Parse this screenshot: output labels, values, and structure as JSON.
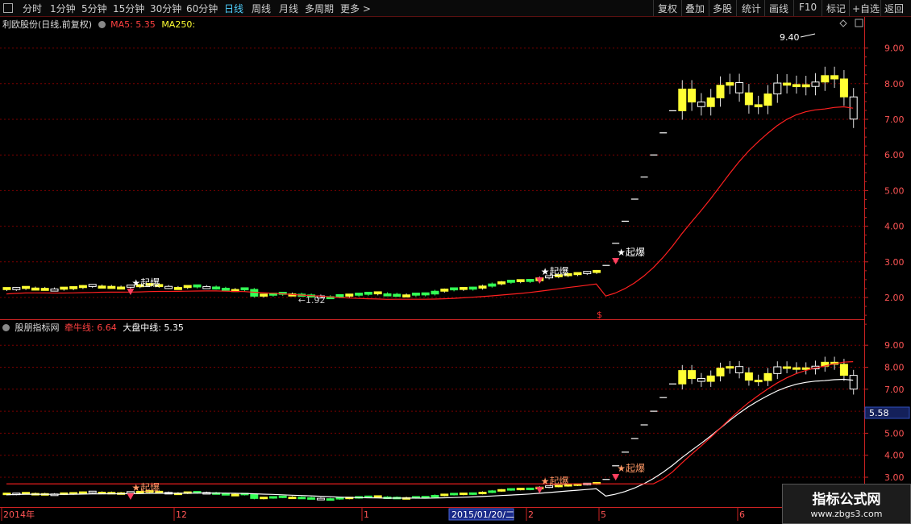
{
  "toolbar": {
    "periods": [
      "分时",
      "1分钟",
      "5分钟",
      "15分钟",
      "30分钟",
      "60分钟",
      "日线",
      "周线",
      "月线",
      "多周期",
      "更多 >"
    ],
    "active_period": "日线",
    "right_buttons": [
      "复权",
      "叠加",
      "多股",
      "统计",
      "画线",
      "F10",
      "标记",
      "+自选",
      "返回"
    ]
  },
  "price_panel": {
    "title": "利欧股份(日线,前复权)",
    "ma5": "MA5: 5.35",
    "ma250": "MA250:",
    "high_label": "9.40",
    "low_label": "1.92",
    "signal_label": "起爆",
    "y_ticks": [
      "9.00",
      "8.00",
      "7.00",
      "6.00",
      "5.00",
      "4.00",
      "3.00",
      "2.00"
    ]
  },
  "indicator_panel": {
    "title": "股朋指标网",
    "niu_line": "牵牛线: 6.64",
    "dapan_line": "大盘中线: 5.35",
    "current_value": "5.58",
    "y_ticks": [
      "9.00",
      "8.00",
      "7.00",
      "6.00",
      "5.00",
      "4.00",
      "3.00"
    ]
  },
  "date_axis": {
    "labels": [
      "2014年",
      "12",
      "1",
      "2",
      "5",
      "6"
    ],
    "cursor_date": "2015/01/20/二"
  },
  "watermark": {
    "line1": "指标公式网",
    "line2": "www.zbgs3.com"
  },
  "colors": {
    "up": "#ffff33",
    "down": "#33ff55",
    "flat": "#ffffff",
    "ma": "#ff2a2a",
    "grid": "#7a0000",
    "axis": "#cc2222"
  },
  "chart_data": {
    "type": "candlestick",
    "ma5": 5.35,
    "niu_line": 6.64,
    "dapan_line": 5.35,
    "high": 9.4,
    "low": 1.92
  }
}
